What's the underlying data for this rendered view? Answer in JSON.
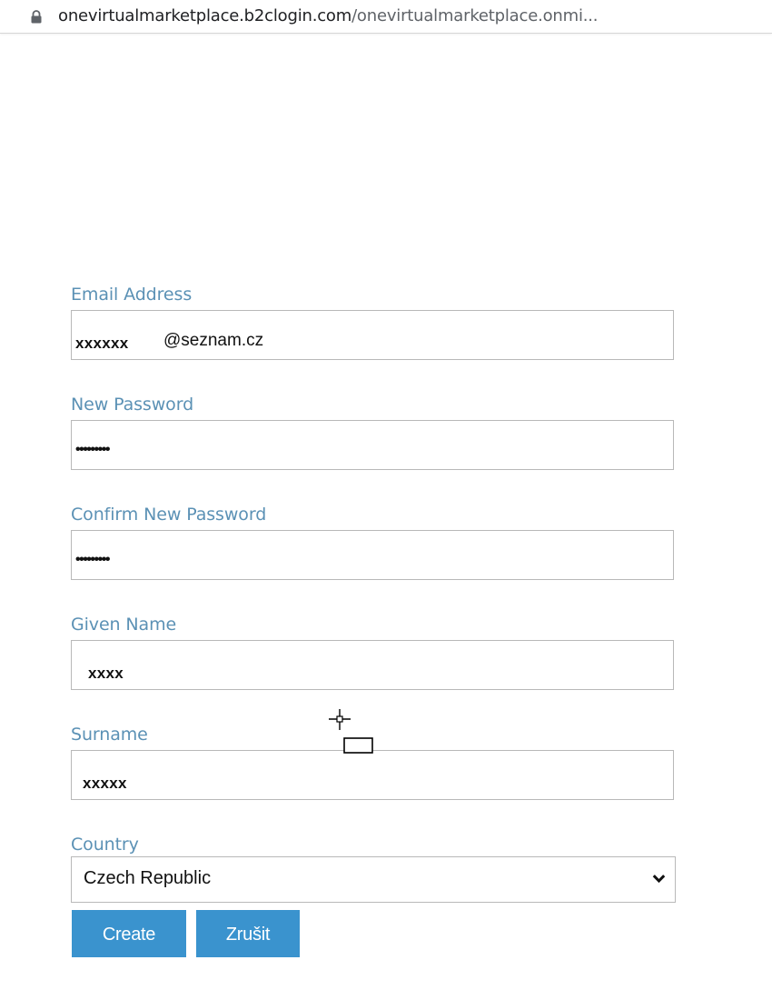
{
  "browser": {
    "url_domain": "onevirtualmarketplace.b2clogin.com",
    "url_path": "/onevirtualmarketplace.onmi...",
    "lock_icon": "lock-icon"
  },
  "form": {
    "email": {
      "label": "Email Address",
      "value_masked": "xxxxxx",
      "value_domain": "@seznam.cz"
    },
    "new_password": {
      "label": "New Password",
      "value": "•••••••••"
    },
    "confirm_password": {
      "label": "Confirm New Password",
      "value": "•••••••••"
    },
    "given_name": {
      "label": "Given Name",
      "value": "xxxx"
    },
    "surname": {
      "label": "Surname",
      "value": "xxxxx"
    },
    "country": {
      "label": "Country",
      "selected": "Czech Republic",
      "icon": "chevron-down-icon"
    },
    "buttons": {
      "create": "Create",
      "cancel": "Zrušit"
    }
  },
  "colors": {
    "label": "#5b91b5",
    "button_bg": "#3a93ce",
    "button_text": "#ffffff",
    "input_border": "#b9b9b9"
  },
  "cursor": "crosshair-cursor-icon"
}
